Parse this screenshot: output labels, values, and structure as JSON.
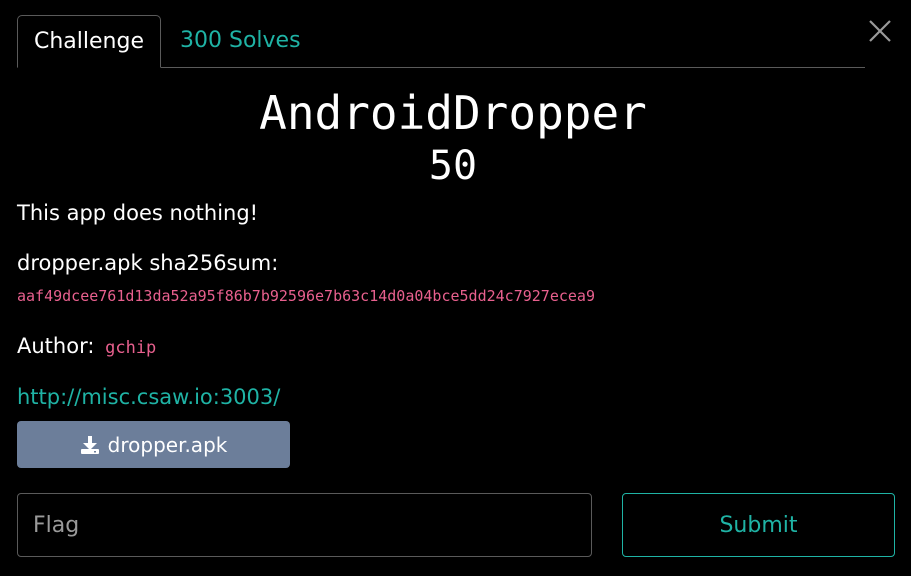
{
  "tabs": {
    "challenge_label": "Challenge",
    "solves_label": "300 Solves"
  },
  "challenge": {
    "name": "AndroidDropper",
    "points": "50",
    "description": "This app does nothing!",
    "hash_label": "dropper.apk sha256sum:",
    "hash_value": "aaf49dcee761d13da52a95f86b7b92596e7b63c14d0a04bce5dd24c7927ecea9",
    "author_label": "Author:",
    "author_value": "gchip",
    "link": "http://misc.csaw.io:3003/",
    "file_label": "dropper.apk"
  },
  "form": {
    "flag_placeholder": "Flag",
    "submit_label": "Submit"
  },
  "colors": {
    "background": "#000000",
    "accent": "#1fb3a5",
    "code": "#e8608e",
    "download_button": "#6c7e9a"
  },
  "icons": {
    "close": "close-icon",
    "download": "download-icon"
  }
}
